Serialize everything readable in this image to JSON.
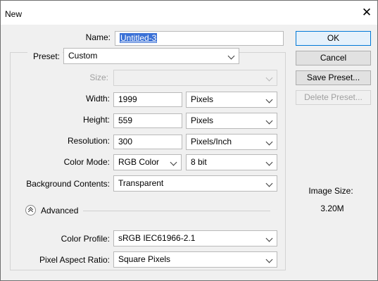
{
  "window": {
    "title": "New"
  },
  "name": {
    "label": "Name:",
    "value": "Untitled-3"
  },
  "preset": {
    "label": "Preset:",
    "value": "Custom"
  },
  "size": {
    "label": "Size:",
    "value": ""
  },
  "width": {
    "label": "Width:",
    "value": "1999",
    "unit": "Pixels"
  },
  "height": {
    "label": "Height:",
    "value": "559",
    "unit": "Pixels"
  },
  "resolution": {
    "label": "Resolution:",
    "value": "300",
    "unit": "Pixels/Inch"
  },
  "color_mode": {
    "label": "Color Mode:",
    "value": "RGB Color",
    "depth": "8 bit"
  },
  "background": {
    "label": "Background Contents:",
    "value": "Transparent"
  },
  "advanced": {
    "label": "Advanced"
  },
  "color_profile": {
    "label": "Color Profile:",
    "value": "sRGB IEC61966-2.1"
  },
  "pixel_aspect": {
    "label": "Pixel Aspect Ratio:",
    "value": "Square Pixels"
  },
  "buttons": {
    "ok": "OK",
    "cancel": "Cancel",
    "save_preset": "Save Preset...",
    "delete_preset": "Delete Preset..."
  },
  "image_size": {
    "label": "Image Size:",
    "value": "3.20M"
  },
  "icons": {
    "close": "close-icon",
    "chevron": "chevron-down-icon",
    "advanced_toggle": "chevron-up-circle-icon"
  },
  "colors": {
    "selection": "#3b71d6",
    "primary_border": "#0078d7"
  }
}
